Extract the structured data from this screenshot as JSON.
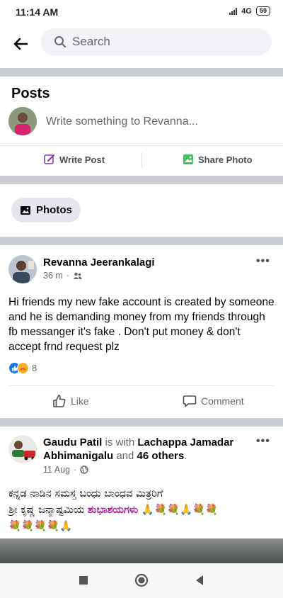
{
  "status_bar": {
    "time": "11:14 AM",
    "network": "4G",
    "battery": "59"
  },
  "search": {
    "placeholder": "Search"
  },
  "profile": {
    "section_title": "Posts",
    "composer_placeholder": "Write something to Revanna...",
    "write_post_label": "Write Post",
    "share_photo_label": "Share Photo",
    "photos_label": "Photos"
  },
  "posts": [
    {
      "author": "Revanna Jeerankalagi",
      "time": "36 m",
      "text": "Hi friends my new fake account is created by someone and he is  demanding money from my friends  through fb messanger  it's fake  . Don't put money & don't accept  frnd request plz",
      "reaction_count": "8",
      "like_label": "Like",
      "comment_label": "Comment"
    },
    {
      "author": "Gaudu Patil",
      "with_word": " is with ",
      "tagged": "Lachappa Jamadar Abhimanigalu",
      "and_word": " and ",
      "others": "46 others",
      "period": ".",
      "time": "11 Aug",
      "text_line1": "ಕನ್ನಡ ನಾಡಿನ ಸಮಸ್ತ ಬಂಧು ಬಾಂಧವ ಮಿತ್ರರಿಗೆ",
      "text_line2_start": "ಶ್ರೀ ಕೃಷ್ಣ ಜನ್ಮಾಷ್ಟಮಿಯ ",
      "text_line2_highlight": "ಶುಭಾಶಯಗಳು",
      "text_emojis_1": " 🙏💐💐🙏💐💐",
      "text_emojis_2": "💐💐💐💐🙏"
    }
  ],
  "colors": {
    "brand_blue": "#1877f2",
    "highlight_purple": "#b01aa7",
    "divider": "#c9ccd1"
  },
  "nav": {
    "icons": [
      "square-recents-icon",
      "circle-home-icon",
      "triangle-back-icon"
    ]
  }
}
